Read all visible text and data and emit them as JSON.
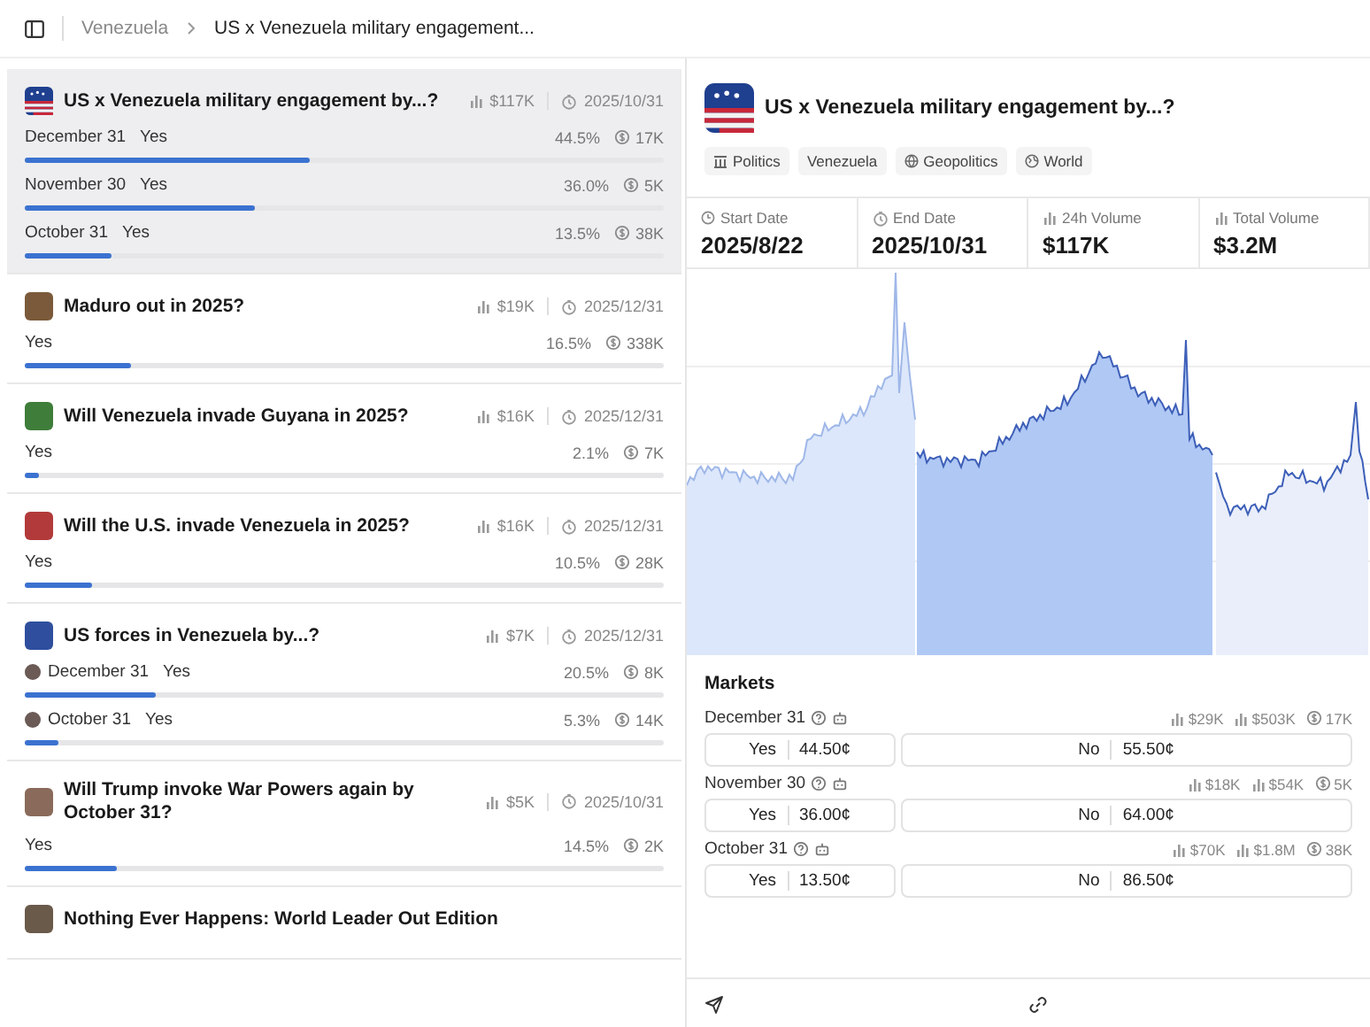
{
  "breadcrumb": [
    {
      "label": "Venezuela"
    },
    {
      "label": "US x Venezuela military engagement..."
    }
  ],
  "events": [
    {
      "title": "US x Venezuela military engagement by...?",
      "volume": "$117K",
      "end_date": "2025/10/31",
      "selected": true,
      "outcomes": [
        {
          "label": "December 31",
          "side": "Yes",
          "percent": "44.5%",
          "traders": "17K",
          "level": 0.445,
          "kind": "plain"
        },
        {
          "label": "November 30",
          "side": "Yes",
          "percent": "36.0%",
          "traders": "5K",
          "level": 0.36,
          "kind": "plain"
        },
        {
          "label": "October 31",
          "side": "Yes",
          "percent": "13.5%",
          "traders": "38K",
          "level": 0.135,
          "kind": "plain"
        }
      ]
    },
    {
      "title": "Maduro out in 2025?",
      "volume": "$19K",
      "end_date": "2025/12/31",
      "selected": false,
      "outcomes": [
        {
          "label": "Yes",
          "percent": "16.5%",
          "traders": "338K",
          "level": 0.165,
          "kind": "plain"
        }
      ]
    },
    {
      "title": "Will Venezuela invade Guyana in 2025?",
      "volume": "$16K",
      "end_date": "2025/12/31",
      "selected": false,
      "outcomes": [
        {
          "label": "Yes",
          "percent": "2.1%",
          "traders": "7K",
          "level": 0.021,
          "kind": "plain"
        }
      ]
    },
    {
      "title": "Will the U.S. invade Venezuela in 2025?",
      "volume": "$16K",
      "end_date": "2025/12/31",
      "selected": false,
      "outcomes": [
        {
          "label": "Yes",
          "percent": "10.5%",
          "traders": "28K",
          "level": 0.105,
          "kind": "plain"
        }
      ]
    },
    {
      "title": "US forces in Venezuela by...?",
      "volume": "$7K",
      "end_date": "2025/12/31",
      "selected": false,
      "outcomes": [
        {
          "label": "December 31",
          "side": "Yes",
          "percent": "20.5%",
          "traders": "8K",
          "level": 0.205,
          "kind": "avatar"
        },
        {
          "label": "October 31",
          "side": "Yes",
          "percent": "5.3%",
          "traders": "14K",
          "level": 0.053,
          "kind": "avatar"
        }
      ]
    },
    {
      "title": "Will Trump invoke War Powers again by October 31?",
      "volume": "$5K",
      "end_date": "2025/10/31",
      "selected": false,
      "outcomes": [
        {
          "label": "Yes",
          "percent": "14.5%",
          "traders": "2K",
          "level": 0.145,
          "kind": "plain"
        }
      ]
    },
    {
      "title": "Nothing Ever Happens: World Leader Out Edition",
      "selected": false
    }
  ],
  "detail": {
    "title": "US x Venezuela military engagement by...?",
    "tags": [
      {
        "label": "Politics"
      },
      {
        "label": "Venezuela"
      },
      {
        "label": "Geopolitics"
      },
      {
        "label": "World"
      }
    ],
    "stats": [
      {
        "label": "Start Date",
        "value": "2025/8/22"
      },
      {
        "label": "End Date",
        "value": "2025/10/31"
      },
      {
        "label": "24h Volume",
        "value": "$117K"
      },
      {
        "label": "Total Volume",
        "value": "$3.2M"
      }
    ],
    "markets_title": "Markets",
    "markets": [
      {
        "label": "December 31",
        "volume_24h": "$29K",
        "volume_total": "$503K",
        "traders": "17K",
        "yes_label": "Yes",
        "yes_price": "44.50¢",
        "no_label": "No",
        "no_price": "55.50¢"
      },
      {
        "label": "November 30",
        "volume_24h": "$18K",
        "volume_total": "$54K",
        "traders": "5K",
        "yes_label": "Yes",
        "yes_price": "36.00¢",
        "no_label": "No",
        "no_price": "64.00¢"
      },
      {
        "label": "October 31",
        "volume_24h": "$70K",
        "volume_total": "$1.8M",
        "traders": "38K",
        "yes_label": "Yes",
        "yes_price": "13.50¢",
        "no_label": "No",
        "no_price": "86.50¢"
      }
    ]
  }
}
